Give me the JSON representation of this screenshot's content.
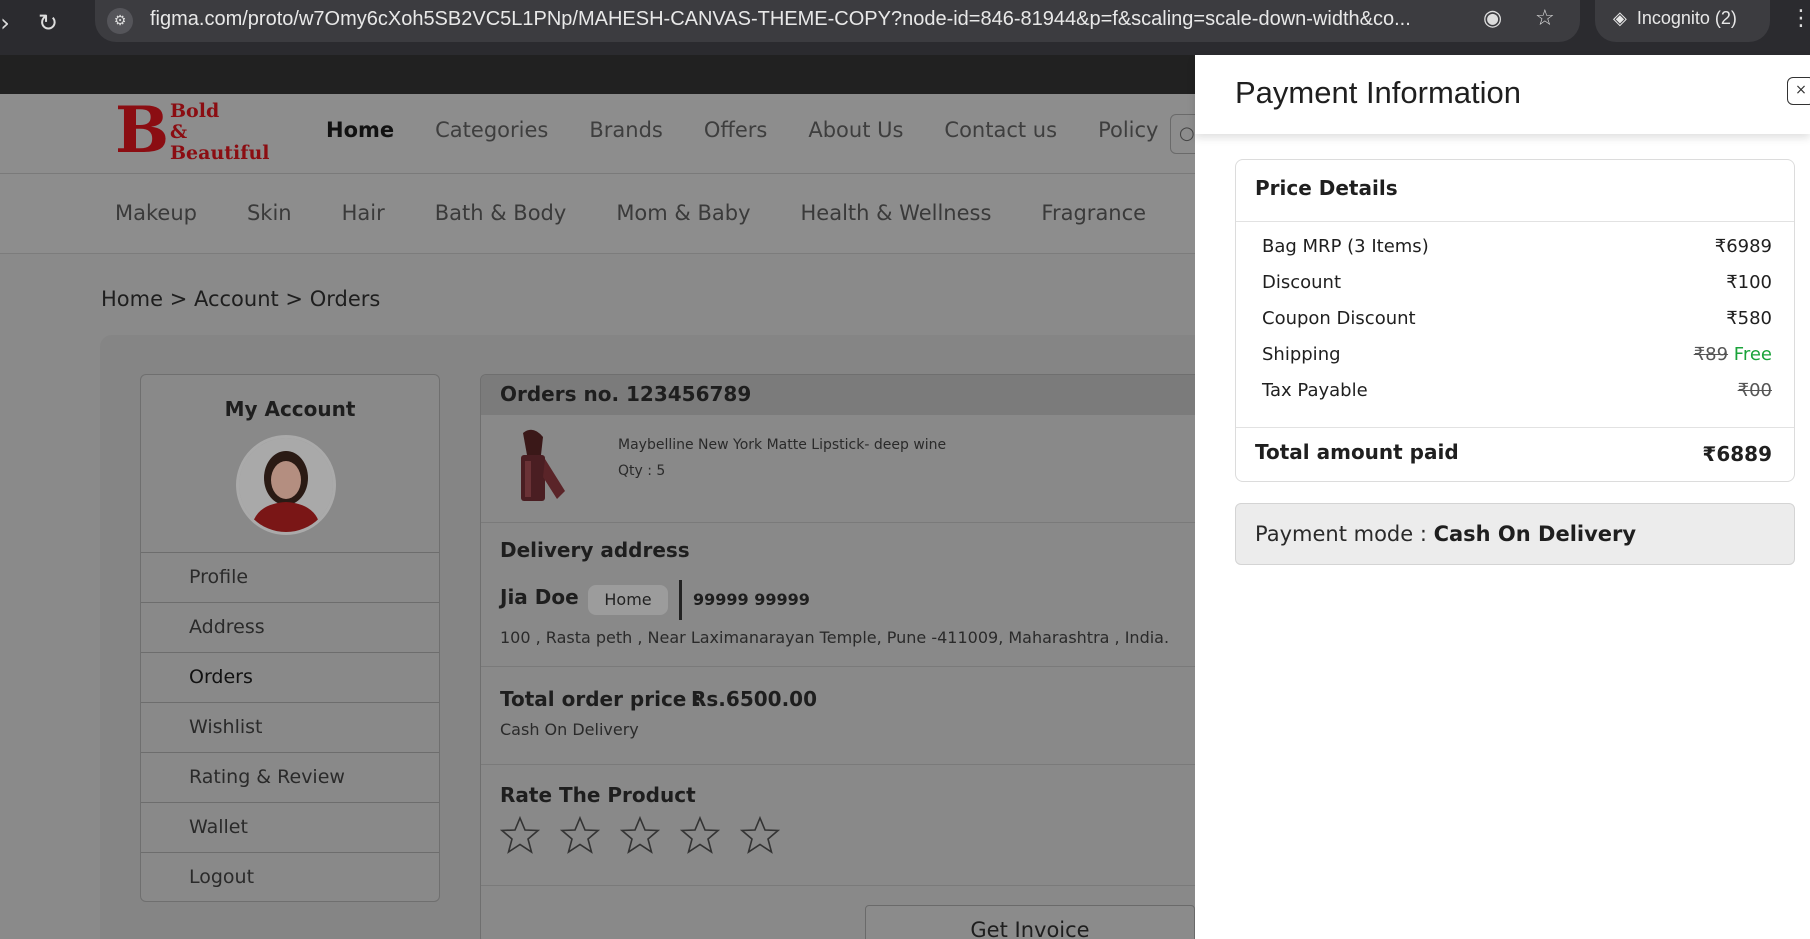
{
  "browser": {
    "url": "figma.com/proto/w7Omy6cXoh5SB2VC5L1PNp/MAHESH-CANVAS-THEME-COPY?node-id=846-81944&p=f&scaling=scale-down-width&co...",
    "incognito_label": "Incognito (2)"
  },
  "site": {
    "brand_lines": "Bold\n&\nBeautiful",
    "main_nav": [
      "Home",
      "Categories",
      "Brands",
      "Offers",
      "About Us",
      "Contact us",
      "Policy"
    ],
    "category_nav": [
      "Makeup",
      "Skin",
      "Hair",
      "Bath & Body",
      "Mom & Baby",
      "Health & Wellness",
      "Fragrance"
    ],
    "breadcrumb": "Home > Account > Orders"
  },
  "account": {
    "title": "My Account",
    "menu": [
      "Profile",
      "Address",
      "Orders",
      "Wishlist",
      "Rating & Review",
      "Wallet",
      "Logout"
    ]
  },
  "order": {
    "header": "Orders no. 123456789",
    "product_name": "Maybelline New York Matte Lipstick-  deep wine",
    "product_qty": "Qty : 5",
    "delivery_title": "Delivery address",
    "customer_name": "Jia Doe",
    "address_tag": "Home",
    "phone": "99999 99999",
    "address": "100 , Rasta peth , Near Laximanarayan Temple, Pune -411009, Maharashtra , India.",
    "total_label": "Total order price :",
    "total_value": "Rs.6500.00",
    "payment_method": "Cash On Delivery",
    "rate_title": "Rate The Product",
    "rating": 0,
    "rating_max": 5,
    "invoice_label": "Get Invoice"
  },
  "drawer": {
    "title": "Payment Information",
    "close_icon": "×",
    "price_details_title": "Price Details",
    "currency": "₹",
    "rows": [
      {
        "label": "Bag MRP (3 Items)",
        "value": "6989"
      },
      {
        "label": "Discount",
        "value": "100"
      },
      {
        "label": "Coupon Discount",
        "value": "580"
      },
      {
        "label": "Shipping",
        "value_struck": "89",
        "value_free": "Free"
      },
      {
        "label": "Tax Payable",
        "value_struck": "00"
      }
    ],
    "total_label": "Total amount paid",
    "total_value": "6889",
    "payment_mode_label": "Payment mode : ",
    "payment_mode_value": "Cash On Delivery",
    "free_color": "#1aa33a"
  }
}
